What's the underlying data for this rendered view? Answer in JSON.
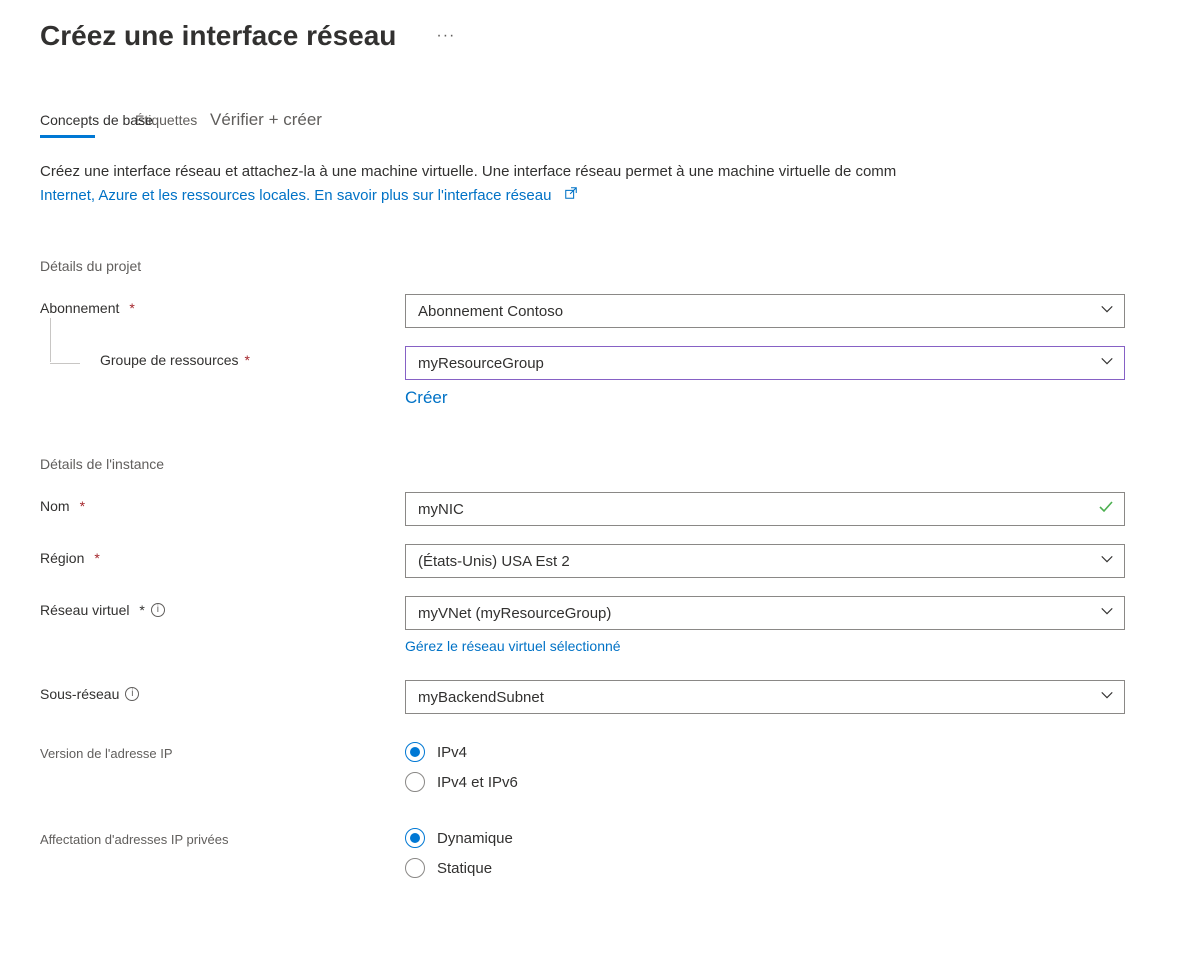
{
  "title": "Créez une interface réseau",
  "tabs": {
    "basics": "Concepts de base",
    "etiquettes": "Étiquettes",
    "review": "Vérifier + créer"
  },
  "intro": {
    "text_before_link": "Créez une interface réseau et attachez-la à une machine virtuelle. Une interface réseau permet à une machine virtuelle de comm",
    "link": "Internet, Azure et les ressources locales. En savoir plus sur l'interface réseau"
  },
  "project": {
    "section": "Détails du projet",
    "subscription": {
      "label": "Abonnement",
      "value": "Abonnement Contoso"
    },
    "resource_group": {
      "label": "Groupe de ressources",
      "value": "myResourceGroup",
      "create": "Créer"
    }
  },
  "instance": {
    "section": "Détails de l'instance",
    "name": {
      "label": "Nom",
      "value": "myNIC"
    },
    "region": {
      "label": "Région",
      "value": "(États-Unis) USA Est 2"
    },
    "vnet": {
      "label": "Réseau virtuel",
      "value": "myVNet (myResourceGroup)",
      "manage": "Gérez le réseau virtuel sélectionné"
    },
    "subnet": {
      "label": "Sous-réseau",
      "value": "myBackendSubnet"
    },
    "ip_version": {
      "label": "Version de l'adresse IP",
      "options": [
        "IPv4",
        "IPv4 et IPv6"
      ],
      "selected": 0
    },
    "ip_assignment": {
      "label": "Affectation d'adresses IP privées",
      "options": [
        "Dynamique",
        "Statique"
      ],
      "selected": 0
    }
  }
}
